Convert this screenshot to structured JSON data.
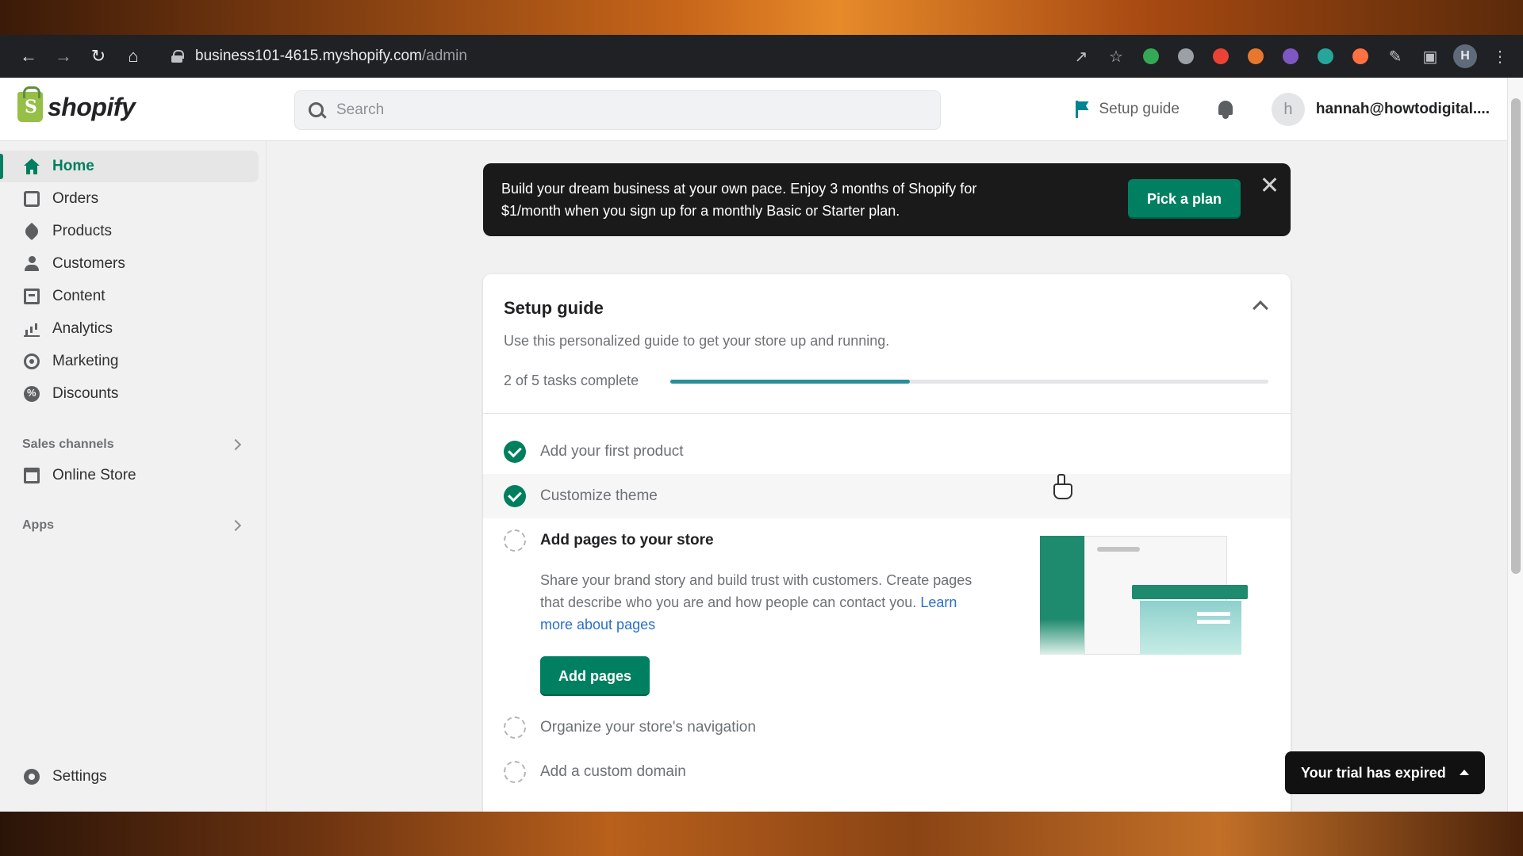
{
  "browser": {
    "url_host": "business101-4615.myshopify.com",
    "url_path": "/admin",
    "profile_initial": "H",
    "extensions": [
      {
        "icon": "share-icon"
      },
      {
        "icon": "star-icon"
      },
      {
        "icon": "extension-green-icon",
        "color": "#34a853"
      },
      {
        "icon": "extension-grey-icon",
        "color": "#9aa0a6"
      },
      {
        "icon": "extension-red-icon",
        "color": "#ea4335"
      },
      {
        "icon": "extension-fox-icon",
        "color": "#e8772e"
      },
      {
        "icon": "extension-purple-icon",
        "color": "#7e57c2"
      },
      {
        "icon": "extension-teal-icon",
        "color": "#26a69a"
      },
      {
        "icon": "extension-orange-icon",
        "color": "#ff7043"
      },
      {
        "icon": "puzzle-icon"
      },
      {
        "icon": "sidepanel-icon"
      }
    ]
  },
  "topbar": {
    "logo_text": "shopify",
    "search_placeholder": "Search",
    "setup_guide_label": "Setup guide",
    "avatar_initial": "h",
    "user_email": "hannah@howtodigital...."
  },
  "sidebar": {
    "items": [
      {
        "label": "Home",
        "icon": "home-icon",
        "active": true
      },
      {
        "label": "Orders",
        "icon": "orders-icon"
      },
      {
        "label": "Products",
        "icon": "products-icon"
      },
      {
        "label": "Customers",
        "icon": "customers-icon"
      },
      {
        "label": "Content",
        "icon": "content-icon"
      },
      {
        "label": "Analytics",
        "icon": "analytics-icon"
      },
      {
        "label": "Marketing",
        "icon": "marketing-icon"
      },
      {
        "label": "Discounts",
        "icon": "discounts-icon"
      }
    ],
    "sales_channels_label": "Sales channels",
    "online_store_label": "Online Store",
    "apps_label": "Apps",
    "settings_label": "Settings"
  },
  "banner": {
    "line1": "Build your dream business at your own pace. Enjoy 3 months of Shopify for",
    "line2": "$1/month when you sign up for a monthly Basic or Starter plan.",
    "button_label": "Pick a plan"
  },
  "setup_guide": {
    "title": "Setup guide",
    "subtitle": "Use this personalized guide to get your store up and running.",
    "progress_label": "2 of 5 tasks complete",
    "progress_fraction": 0.4,
    "progress_color": "#2c8d99",
    "tasks": [
      {
        "label": "Add your first product",
        "status": "complete"
      },
      {
        "label": "Customize theme",
        "status": "complete"
      },
      {
        "label": "Add pages to your store",
        "status": "current"
      },
      {
        "label": "Organize your store's navigation",
        "status": "pending"
      },
      {
        "label": "Add a custom domain",
        "status": "pending"
      }
    ],
    "current_desc": "Share your brand story and build trust with customers. Create pages that describe who you are and how people can contact you.",
    "current_link": "Learn more about pages",
    "current_button": "Add pages"
  },
  "toast": {
    "label": "Your trial has expired"
  },
  "colors": {
    "accent": "#008060",
    "banner_bg": "#1a1a1a"
  }
}
